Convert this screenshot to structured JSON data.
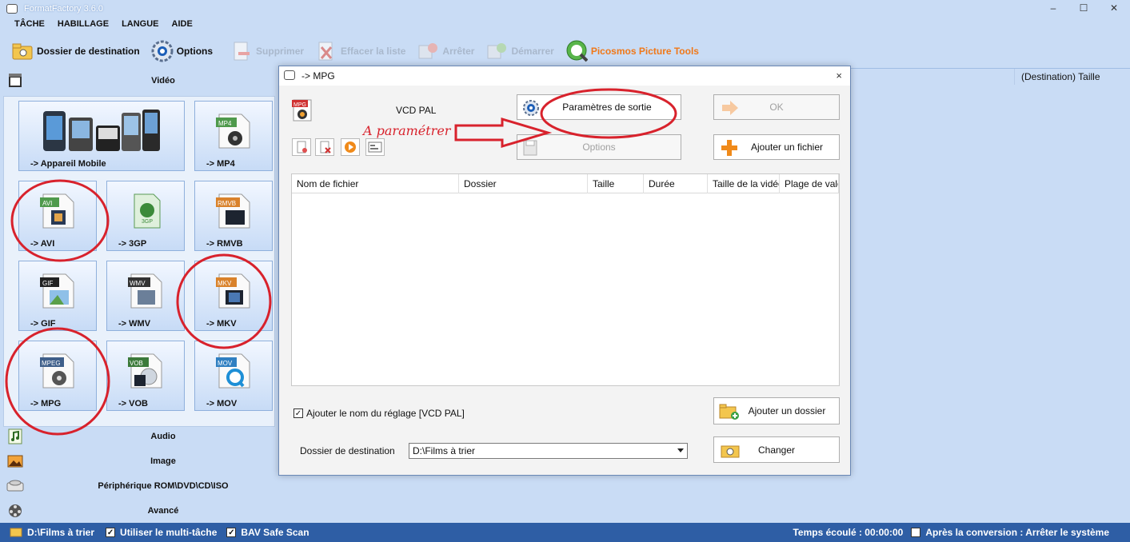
{
  "window": {
    "title": "FormatFactory 3.6.0",
    "minimize": "‒",
    "maximize": "☐",
    "close": "✕"
  },
  "menu": [
    "TÂCHE",
    "HABILLAGE",
    "LANGUE",
    "AIDE"
  ],
  "toolbar": {
    "destination": "Dossier de destination",
    "options": "Options",
    "delete": "Supprimer",
    "clear": "Effacer la liste",
    "stop": "Arrêter",
    "start": "Démarrer",
    "picosmos": "Picosmos Picture Tools"
  },
  "left": {
    "video": "Vidéo",
    "audio": "Audio",
    "image": "Image",
    "rom": "Périphérique ROM\\DVD\\CD\\ISO",
    "advanced": "Avancé",
    "tiles": [
      {
        "label": "-> Appareil Mobile",
        "badge": ""
      },
      {
        "label": "-> MP4",
        "badge": "MP4"
      },
      {
        "label": "-> AVI",
        "badge": "AVI"
      },
      {
        "label": "-> 3GP",
        "badge": "3GP"
      },
      {
        "label": "-> RMVB",
        "badge": "RMVB"
      },
      {
        "label": "-> GIF",
        "badge": "GIF"
      },
      {
        "label": "-> WMV",
        "badge": "WMV"
      },
      {
        "label": "-> MKV",
        "badge": "MKV"
      },
      {
        "label": "-> MPG",
        "badge": "MPEG"
      },
      {
        "label": "-> VOB",
        "badge": "VOB"
      },
      {
        "label": "-> MOV",
        "badge": "MOV"
      }
    ]
  },
  "list": {
    "size_header": "(Destination) Taille"
  },
  "dialog": {
    "title": "-> MPG",
    "close": "×",
    "preset": "VCD PAL",
    "format_badge": "MPG",
    "output_params": "Paramètres de sortie",
    "ok": "OK",
    "options": "Options",
    "add_file": "Ajouter un fichier",
    "columns": [
      "Nom de fichier",
      "Dossier",
      "Taille",
      "Durée",
      "Taille de la vidéo",
      "Plage de valeu"
    ],
    "add_preset_name": "Ajouter le nom du réglage [VCD PAL]",
    "add_folder": "Ajouter un dossier",
    "dest_label": "Dossier de destination",
    "dest_value": "D:\\Films à trier",
    "change": "Changer"
  },
  "annotation": "A paramétrer",
  "status": {
    "folder": "D:\\Films à trier",
    "multitask": "Utiliser le multi-tâche",
    "bav": "BAV Safe Scan",
    "elapsed": "Temps écoulé : 00:00:00",
    "after": "Après la conversion : Arrêter le système"
  },
  "colors": {
    "annotation_red": "#d8222c",
    "status_bar": "#2e5ea5",
    "brand_orange": "#f07818",
    "bg": "#c9dcf5"
  }
}
